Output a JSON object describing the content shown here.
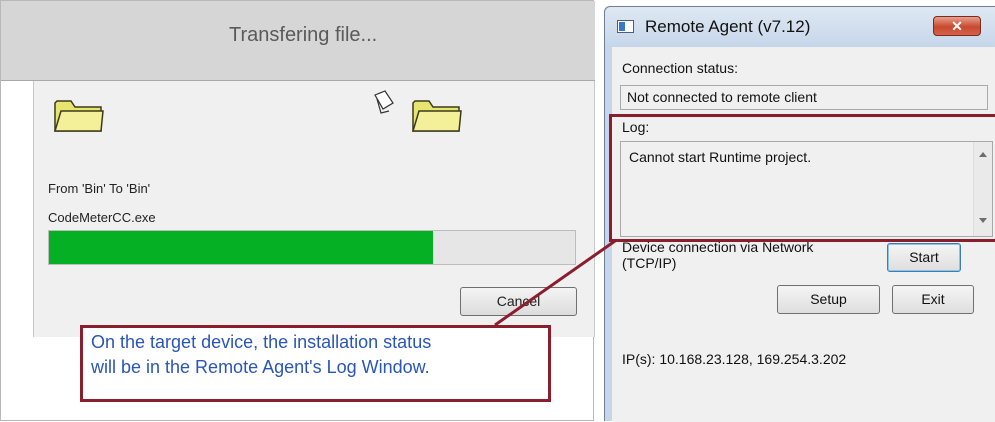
{
  "transfer_dialog": {
    "title": "Transfering file...",
    "from_to": "From 'Bin' To 'Bin'",
    "filename": "CodeMeterCC.exe",
    "progress_fraction": 0.73,
    "cancel_label": "Cancel",
    "progress_color": "#06b025"
  },
  "remote_agent": {
    "title": "Remote Agent (v7.12)",
    "close_label": "✕",
    "connection_status_label": "Connection status:",
    "connection_status_value": "Not connected to remote client",
    "log_label": "Log:",
    "log_text": "Cannot start Runtime project.",
    "device_connection_line1": "Device connection via Network",
    "device_connection_line2": "(TCP/IP)",
    "start_label": "Start",
    "setup_label": "Setup",
    "exit_label": "Exit",
    "ip_text": "IP(s): 10.168.23.128, 169.254.3.202"
  },
  "annotation": {
    "line1": "On the target device, the installation status",
    "line2": "will be in the Remote Agent's Log Window.",
    "color": "#8a1e2c"
  },
  "icons": [
    "folder-icon",
    "document-icon",
    "app-icon",
    "close-icon",
    "scroll-up-icon",
    "scroll-down-icon"
  ]
}
